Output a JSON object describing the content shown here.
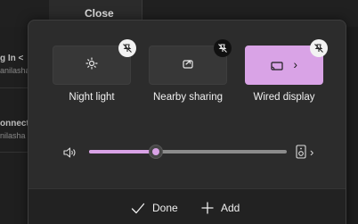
{
  "background": {
    "close_label": "Close",
    "left_text_1": "g In <",
    "left_text_2": "anilasha",
    "left_text_3": "onnect",
    "left_text_4": "nilasha"
  },
  "quick_settings": {
    "tiles": [
      {
        "label": "Night light",
        "icon": "brightness-icon",
        "active": false,
        "pin_state": "unpin"
      },
      {
        "label": "Nearby sharing",
        "icon": "share-icon",
        "active": false,
        "pin_state": "unpin"
      },
      {
        "label": "Wired display",
        "icon": "cast-icon",
        "active": true,
        "pin_state": "unpin",
        "chevron": "›"
      }
    ],
    "volume": {
      "level_fraction": 0.34,
      "chevron": "›"
    },
    "footer": {
      "done_label": "Done",
      "add_label": "Add"
    }
  },
  "colors": {
    "accent": "#d9a3e6",
    "panel": "#2c2c2c",
    "footer": "#222222"
  }
}
